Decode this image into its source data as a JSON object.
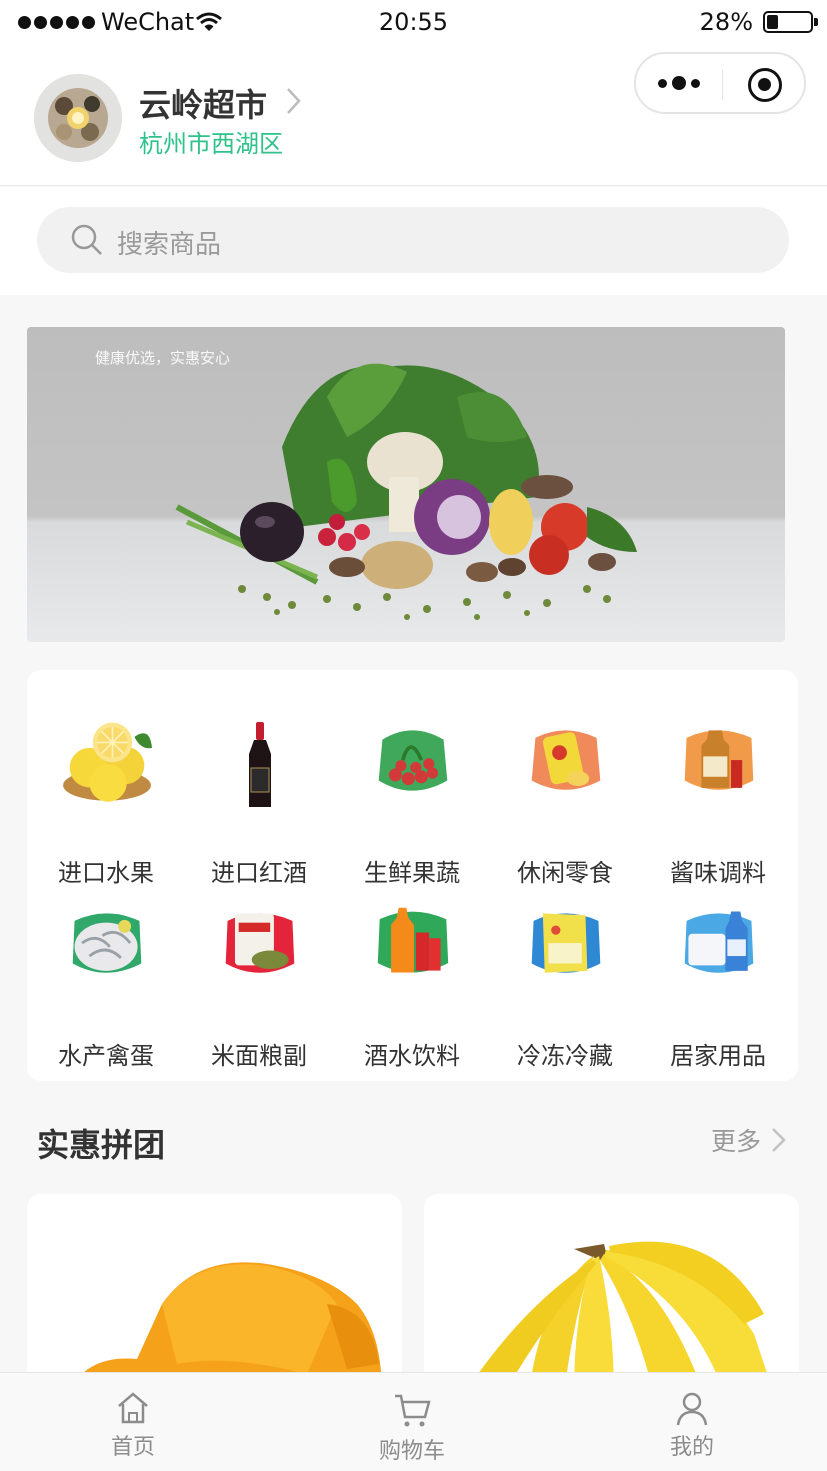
{
  "status_bar": {
    "carrier": "WeChat",
    "time": "20:55",
    "battery": "28%",
    "battery_level": 0.28
  },
  "store": {
    "name": "云岭超市",
    "location": "杭州市西湖区"
  },
  "search": {
    "placeholder": "搜索商品"
  },
  "banner": {
    "slogan": "健康优选，实惠安心"
  },
  "categories": [
    {
      "label": "进口水果",
      "icon": "lemon-icon"
    },
    {
      "label": "进口红酒",
      "icon": "wine-bottle-icon"
    },
    {
      "label": "生鲜果蔬",
      "icon": "vegetables-icon"
    },
    {
      "label": "休闲零食",
      "icon": "snacks-icon"
    },
    {
      "label": "酱味调料",
      "icon": "condiments-icon"
    },
    {
      "label": "水产禽蛋",
      "icon": "shrimp-icon"
    },
    {
      "label": "米面粮副",
      "icon": "rice-bag-icon"
    },
    {
      "label": "酒水饮料",
      "icon": "drinks-icon"
    },
    {
      "label": "冷冻冷藏",
      "icon": "frozen-food-icon"
    },
    {
      "label": "居家用品",
      "icon": "household-icon"
    }
  ],
  "section": {
    "title": "实惠拼团",
    "more": "更多"
  },
  "tabs": [
    {
      "label": "首页",
      "icon": "home-icon"
    },
    {
      "label": "购物车",
      "icon": "cart-icon"
    },
    {
      "label": "我的",
      "icon": "user-icon"
    }
  ],
  "colors": {
    "accent": "#2ec28a",
    "tab_inactive": "#8c8c8c"
  }
}
